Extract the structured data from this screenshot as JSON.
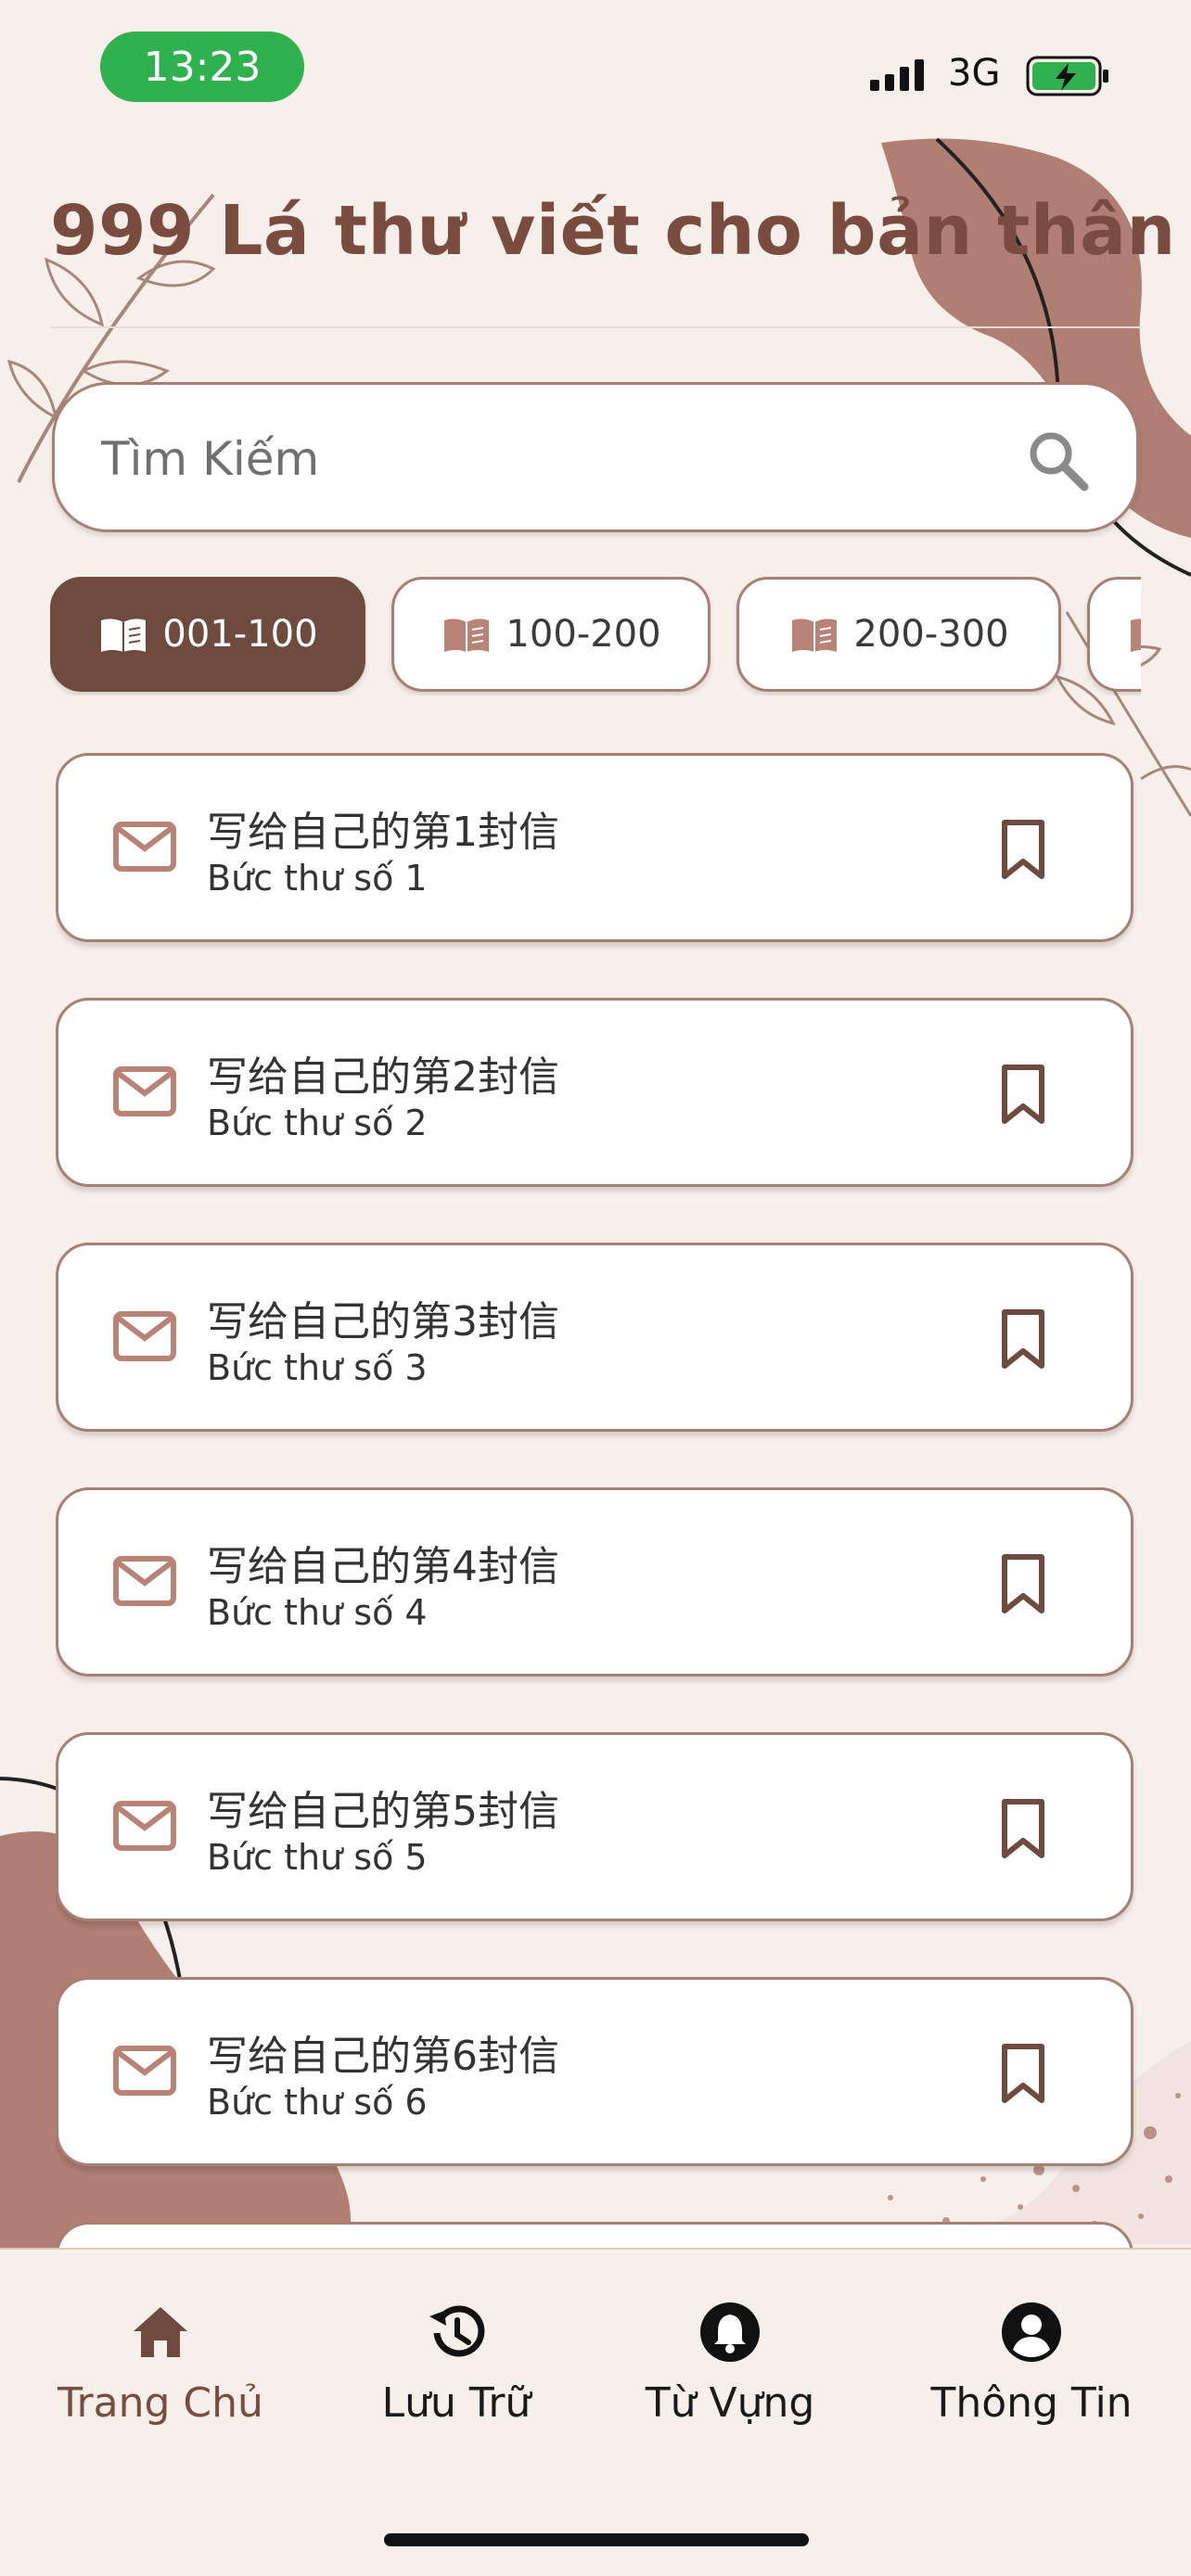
{
  "status_bar": {
    "time": "13:23",
    "network": "3G",
    "accent": "#2fb14f"
  },
  "header": {
    "title": "999 Lá thư viết cho bản thân"
  },
  "search": {
    "placeholder": "Tìm Kiếm",
    "value": ""
  },
  "categories": [
    {
      "label": "001-100",
      "icon": "book-icon",
      "active": true
    },
    {
      "label": "100-200",
      "icon": "book-icon",
      "active": false
    },
    {
      "label": "200-300",
      "icon": "book-icon",
      "active": false
    }
  ],
  "letters": [
    {
      "title": "写给自己的第1封信",
      "subtitle": "Bức thư số 1"
    },
    {
      "title": "写给自己的第2封信",
      "subtitle": "Bức thư số 2"
    },
    {
      "title": "写给自己的第3封信",
      "subtitle": "Bức thư số 3"
    },
    {
      "title": "写给自己的第4封信",
      "subtitle": "Bức thư số 4"
    },
    {
      "title": "写给自己的第5封信",
      "subtitle": "Bức thư số 5"
    },
    {
      "title": "写给自己的第6封信",
      "subtitle": "Bức thư số 6"
    }
  ],
  "nav": [
    {
      "label": "Trang Chủ",
      "icon": "home-icon",
      "active": true
    },
    {
      "label": "Lưu Trữ",
      "icon": "history-icon",
      "active": false
    },
    {
      "label": "Từ Vựng",
      "icon": "bell-icon",
      "active": false
    },
    {
      "label": "Thông Tin",
      "icon": "account-icon",
      "active": false
    }
  ],
  "colors": {
    "background": "#f7efea",
    "brand_brown": "#6e4a3f",
    "title_brown": "#7a4c40",
    "icon_rose": "#b98377",
    "card_border": "#a77f74",
    "blob": "#b07e73"
  }
}
